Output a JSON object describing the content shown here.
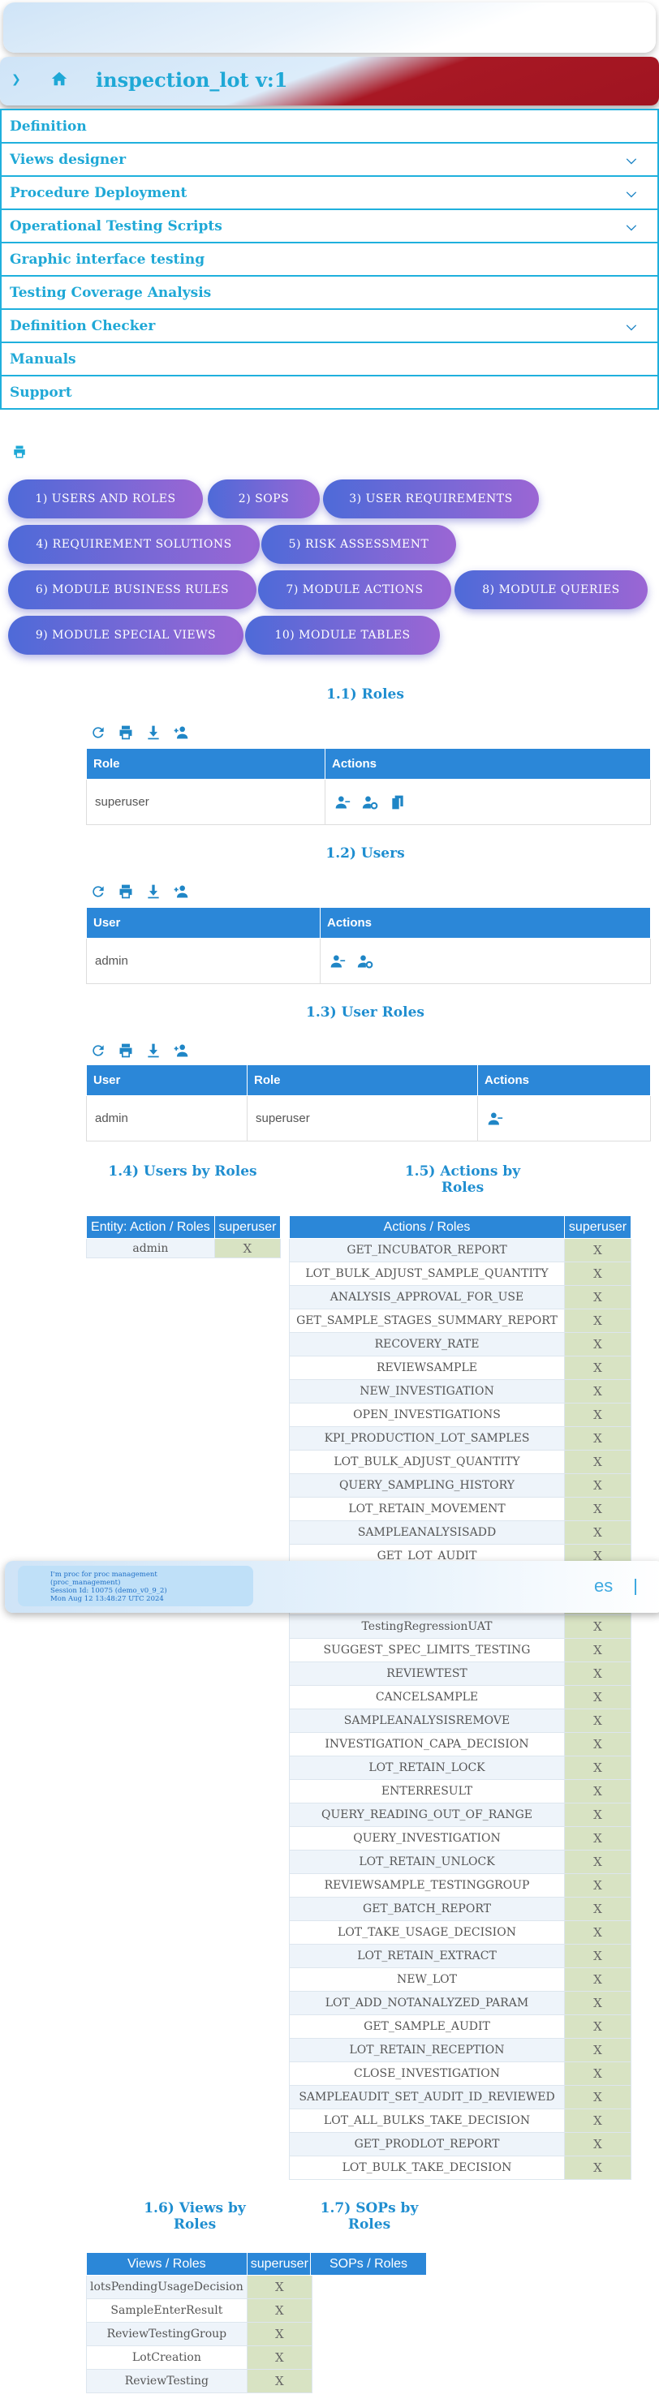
{
  "header": {
    "title": "inspection_lot v:1"
  },
  "menu": [
    {
      "label": "Definition",
      "dropdown": false
    },
    {
      "label": "Views designer",
      "dropdown": true
    },
    {
      "label": "Procedure Deployment",
      "dropdown": true
    },
    {
      "label": "Operational Testing Scripts",
      "dropdown": true
    },
    {
      "label": "Graphic interface testing",
      "dropdown": false
    },
    {
      "label": "Testing Coverage Analysis",
      "dropdown": false
    },
    {
      "label": "Definition Checker",
      "dropdown": true
    },
    {
      "label": "Manuals",
      "dropdown": false
    },
    {
      "label": "Support",
      "dropdown": false
    }
  ],
  "tabs": [
    "1) USERS AND ROLES",
    "2) SOPS",
    "3) USER REQUIREMENTS",
    "4) REQUIREMENT SOLUTIONS",
    "5) RISK ASSESSMENT",
    "6) MODULE BUSINESS RULES",
    "7) MODULE ACTIONS",
    "8) MODULE QUERIES",
    "9) MODULE SPECIAL VIEWS",
    "10) MODULE TABLES"
  ],
  "sections": {
    "roles": "1.1) Roles",
    "users": "1.2) Users",
    "user_roles": "1.3) User Roles",
    "users_by_roles": "1.4) Users by Roles",
    "actions_by_roles": "1.5) Actions by Roles",
    "views_by_roles": "1.6) Views by Roles",
    "sops_by_roles": "1.7) SOPs by Roles"
  },
  "roles_table": {
    "headers": [
      "Role",
      "Actions"
    ],
    "rows": [
      [
        "superuser"
      ]
    ]
  },
  "users_table": {
    "headers": [
      "User",
      "Actions"
    ],
    "rows": [
      [
        "admin"
      ]
    ]
  },
  "user_roles_table": {
    "headers": [
      "User",
      "Role",
      "Actions"
    ],
    "rows": [
      [
        "admin",
        "superuser"
      ]
    ]
  },
  "users_by_roles": {
    "headers": [
      "Entity: Action / Roles",
      "superuser"
    ],
    "rows": [
      [
        "admin",
        "X"
      ]
    ]
  },
  "actions_by_roles": {
    "headers": [
      "Actions / Roles",
      "superuser"
    ],
    "rows": [
      "GET_INCUBATOR_REPORT",
      "LOT_BULK_ADJUST_SAMPLE_QUANTITY",
      "ANALYSIS_APPROVAL_FOR_USE",
      "GET_SAMPLE_STAGES_SUMMARY_REPORT",
      "RECOVERY_RATE",
      "REVIEWSAMPLE",
      "NEW_INVESTIGATION",
      "OPEN_INVESTIGATIONS",
      "KPI_PRODUCTION_LOT_SAMPLES",
      "LOT_BULK_ADJUST_QUANTITY",
      "QUERY_SAMPLING_HISTORY",
      "LOT_RETAIN_MOVEMENT",
      "SAMPLEANALYSISADD",
      "GET_LOT_AUDIT",
      "",
      "",
      "TestingRegressionUAT",
      "SUGGEST_SPEC_LIMITS_TESTING",
      "REVIEWTEST",
      "CANCELSAMPLE",
      "SAMPLEANALYSISREMOVE",
      "INVESTIGATION_CAPA_DECISION",
      "LOT_RETAIN_LOCK",
      "ENTERRESULT",
      "QUERY_READING_OUT_OF_RANGE",
      "QUERY_INVESTIGATION",
      "LOT_RETAIN_UNLOCK",
      "REVIEWSAMPLE_TESTINGGROUP",
      "GET_BATCH_REPORT",
      "LOT_TAKE_USAGE_DECISION",
      "LOT_RETAIN_EXTRACT",
      "NEW_LOT",
      "LOT_ADD_NOTANALYZED_PARAM",
      "GET_SAMPLE_AUDIT",
      "LOT_RETAIN_RECEPTION",
      "CLOSE_INVESTIGATION",
      "SAMPLEAUDIT_SET_AUDIT_ID_REVIEWED",
      "LOT_ALL_BULKS_TAKE_DECISION",
      "GET_PRODLOT_REPORT",
      "LOT_BULK_TAKE_DECISION"
    ],
    "mark": "X"
  },
  "views_by_roles": {
    "headers": [
      "Views / Roles",
      "superuser"
    ],
    "rows": [
      "lotsPendingUsageDecision",
      "SampleEnterResult",
      "ReviewTestingGroup",
      "LotCreation",
      "ReviewTesting"
    ],
    "mark": "X"
  },
  "sops_by_roles": {
    "headers": [
      "SOPs / Roles"
    ]
  },
  "toast": {
    "line1": "I'm proc for proc management (proc_management)",
    "line2": "Session Id: 10075 (demo_v0_9_2)",
    "line3": "Mon Aug 12 13:48:27 UTC 2024",
    "right": "es"
  }
}
